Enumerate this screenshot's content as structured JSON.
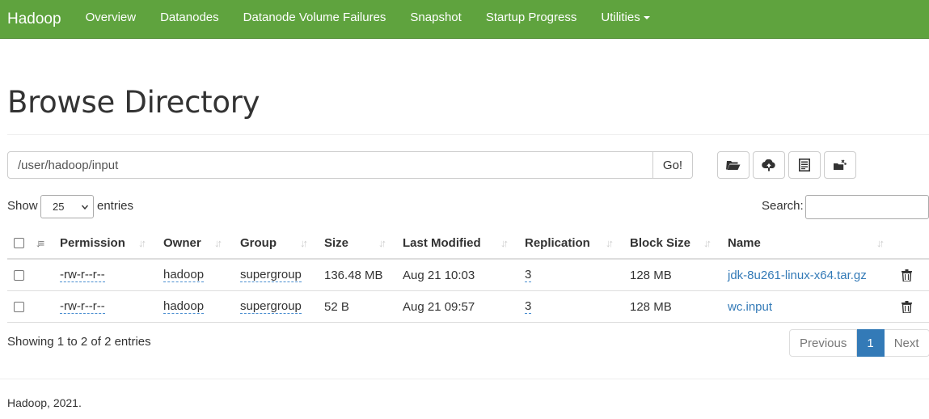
{
  "nav": {
    "brand": "Hadoop",
    "items": [
      "Overview",
      "Datanodes",
      "Datanode Volume Failures",
      "Snapshot",
      "Startup Progress",
      "Utilities"
    ]
  },
  "page": {
    "title": "Browse Directory"
  },
  "path": {
    "value": "/user/hadoop/input",
    "go_label": "Go!"
  },
  "toolbar": {
    "icons": [
      "folder-open-icon",
      "cloud-upload-icon",
      "list-icon",
      "cut-paste-icon"
    ]
  },
  "controls": {
    "show_label": "Show",
    "page_size": "25",
    "entries_label": "entries",
    "search_label": "Search:"
  },
  "table": {
    "headers": [
      "Permission",
      "Owner",
      "Group",
      "Size",
      "Last Modified",
      "Replication",
      "Block Size",
      "Name"
    ],
    "rows": [
      {
        "permission": "-rw-r--r--",
        "owner": "hadoop",
        "group": "supergroup",
        "size": "136.48 MB",
        "modified": "Aug 21 10:03",
        "replication": "3",
        "block_size": "128 MB",
        "name": "jdk-8u261-linux-x64.tar.gz"
      },
      {
        "permission": "-rw-r--r--",
        "owner": "hadoop",
        "group": "supergroup",
        "size": "52 B",
        "modified": "Aug 21 09:57",
        "replication": "3",
        "block_size": "128 MB",
        "name": "wc.input"
      }
    ]
  },
  "info": "Showing 1 to 2 of 2 entries",
  "pagination": {
    "previous": "Previous",
    "current": "1",
    "next": "Next"
  },
  "footer": "Hadoop, 2021.",
  "colors": {
    "navbar": "#5fa33e",
    "link": "#337ab7",
    "active_page": "#337ab7"
  }
}
